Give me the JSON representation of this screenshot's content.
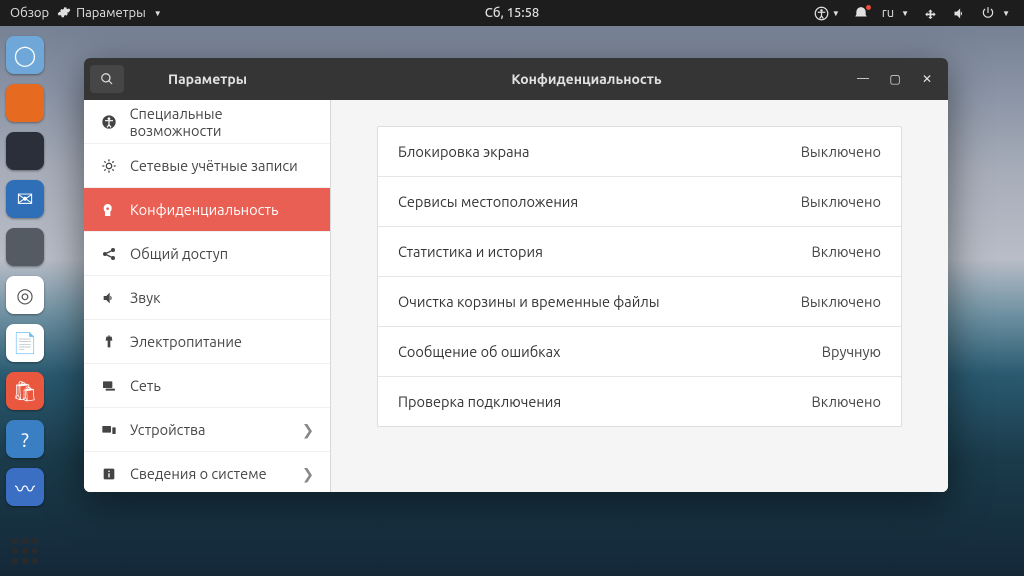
{
  "topbar": {
    "activities": "Обзор",
    "app_menu": "Параметры",
    "clock": "Сб, 15:58",
    "lang": "ru"
  },
  "window": {
    "sidebar_title": "Параметры",
    "content_title": "Конфиденциальность"
  },
  "sidebar": [
    {
      "icon": "accessibility",
      "label": "Специальные возможности",
      "chevron": false
    },
    {
      "icon": "accounts",
      "label": "Сетевые учётные записи",
      "chevron": false
    },
    {
      "icon": "privacy",
      "label": "Конфиденциальность",
      "chevron": false,
      "selected": true
    },
    {
      "icon": "share",
      "label": "Общий доступ",
      "chevron": false
    },
    {
      "icon": "sound",
      "label": "Звук",
      "chevron": false
    },
    {
      "icon": "power",
      "label": "Электропитание",
      "chevron": false
    },
    {
      "icon": "network",
      "label": "Сеть",
      "chevron": false
    },
    {
      "icon": "devices",
      "label": "Устройства",
      "chevron": true
    },
    {
      "icon": "about",
      "label": "Сведения о системе",
      "chevron": true
    }
  ],
  "privacy_rows": [
    {
      "label": "Блокировка экрана",
      "value": "Выключено"
    },
    {
      "label": "Сервисы местоположения",
      "value": "Выключено"
    },
    {
      "label": "Статистика и история",
      "value": "Включено"
    },
    {
      "label": "Очистка корзины и временные файлы",
      "value": "Выключено"
    },
    {
      "label": "Сообщение об ошибках",
      "value": "Вручную"
    },
    {
      "label": "Проверка подключения",
      "value": "Включено"
    }
  ],
  "dock": [
    {
      "name": "chromium",
      "bg": "#6fa8d8",
      "glyph": "◯"
    },
    {
      "name": "firefox",
      "bg": "#e66a1f",
      "glyph": ""
    },
    {
      "name": "vscode",
      "bg": "#2a2f3a",
      "glyph": ""
    },
    {
      "name": "thunderbird",
      "bg": "#2f6fb8",
      "glyph": "✉"
    },
    {
      "name": "screenshot",
      "bg": "#555b63",
      "glyph": ""
    },
    {
      "name": "utility",
      "bg": "#ffffff",
      "glyph": "◎"
    },
    {
      "name": "writer",
      "bg": "#ffffff",
      "glyph": "📄"
    },
    {
      "name": "software",
      "bg": "#e9573f",
      "glyph": "🛍"
    },
    {
      "name": "help",
      "bg": "#3a7fc4",
      "glyph": "?"
    },
    {
      "name": "monitor",
      "bg": "#3a6fc4",
      "glyph": "〰"
    }
  ]
}
